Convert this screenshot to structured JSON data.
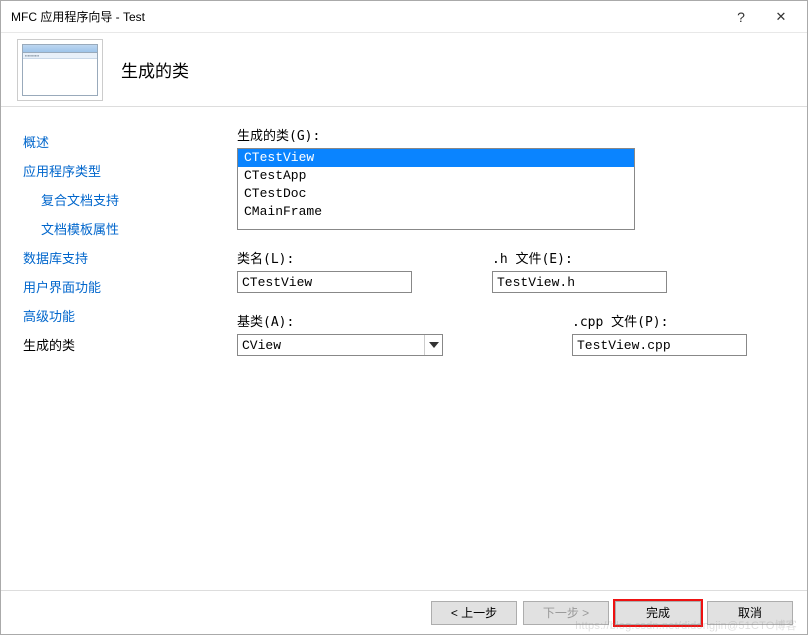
{
  "titlebar": {
    "title": "MFC 应用程序向导 - Test",
    "help": "?",
    "close": "✕"
  },
  "header": {
    "title": "生成的类"
  },
  "sidebar": {
    "items": [
      {
        "label": "概述",
        "sub": false,
        "active": false
      },
      {
        "label": "应用程序类型",
        "sub": false,
        "active": false
      },
      {
        "label": "复合文档支持",
        "sub": true,
        "active": false
      },
      {
        "label": "文档模板属性",
        "sub": true,
        "active": false
      },
      {
        "label": "数据库支持",
        "sub": false,
        "active": false
      },
      {
        "label": "用户界面功能",
        "sub": false,
        "active": false
      },
      {
        "label": "高级功能",
        "sub": false,
        "active": false
      },
      {
        "label": "生成的类",
        "sub": false,
        "active": true
      }
    ]
  },
  "main": {
    "generatedLabel": "生成的类(G):",
    "classes": [
      {
        "name": "CTestView",
        "selected": true
      },
      {
        "name": "CTestApp",
        "selected": false
      },
      {
        "name": "CTestDoc",
        "selected": false
      },
      {
        "name": "CMainFrame",
        "selected": false
      }
    ],
    "classNameLabel": "类名(L):",
    "classNameValue": "CTestView",
    "hFileLabel": ".h 文件(E):",
    "hFileValue": "TestView.h",
    "baseClassLabel": "基类(A):",
    "baseClassValue": "CView",
    "cppFileLabel": ".cpp 文件(P):",
    "cppFileValue": "TestView.cpp"
  },
  "footer": {
    "prev": "< 上一步",
    "next": "下一步 >",
    "finish": "完成",
    "cancel": "取消"
  },
  "watermark": "https://blog.csdn.net/didongjin@51CTO博客"
}
